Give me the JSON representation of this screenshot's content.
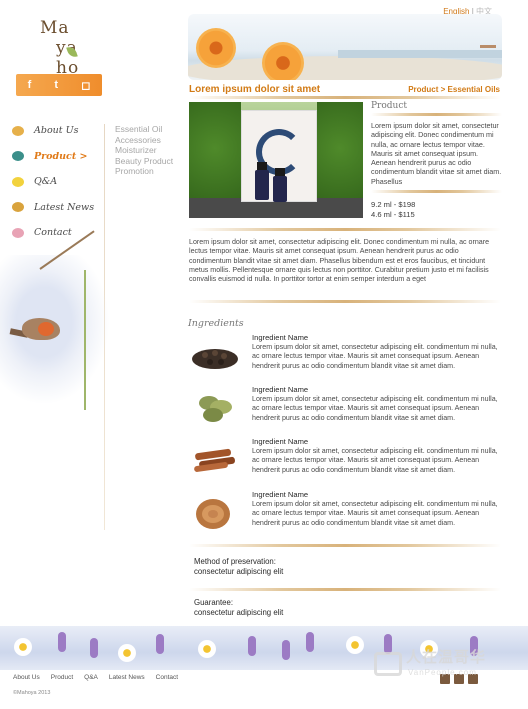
{
  "header": {
    "logo_top": "Ma",
    "logo_bottom": "ya ho",
    "lang_english": "English",
    "lang_sep": "|",
    "lang_chinese": "中文"
  },
  "social": {
    "facebook_icon": "f",
    "twitter_icon": "t",
    "instagram_icon": "◻"
  },
  "nav": {
    "items": [
      {
        "label": "About Us",
        "icon_color": "#e6b04a",
        "active": false
      },
      {
        "label": "Product >",
        "icon_color": "#3b8f8a",
        "active": true
      },
      {
        "label": "Q&A",
        "icon_color": "#f2d23d",
        "active": false
      },
      {
        "label": "Latest News",
        "icon_color": "#d9a33d",
        "active": false
      },
      {
        "label": "Contact",
        "icon_color": "#e8a3b5",
        "active": false
      }
    ]
  },
  "subnav": {
    "items": [
      "Essential Oil",
      "Accessories",
      "Moisturizer",
      "Beauty Product",
      "Promotion"
    ]
  },
  "main": {
    "title": "Lorem ipsum dolor sit amet",
    "breadcrumb": "Product > Essential Oils",
    "product_heading": "Product",
    "product_description": "Lorem ipsum dolor sit amet, consectetur adipiscing elit. Donec condimentum mi nulla, ac ornare lectus tempor vitae. Mauris sit amet consequat ipsum. Aenean hendrerit purus ac odio condimentum blandit vitae sit amet diam. Phasellus",
    "price_1": "9.2 ml - $198",
    "price_2": "4.6 ml - $115",
    "long_paragraph": "Lorem ipsum dolor sit amet, consectetur adipiscing elit. Donec condimentum mi nulla, ac ornare lectus tempor vitae. Mauris sit amet consequat ipsum. Aenean hendrerit purus ac odio condimentum blandit vitae sit amet diam. Phasellus bibendum est et eros faucibus, et tincidunt metus mollis. Pellentesque ornare quis lectus non porttitor. Curabitur pretium justo et mi facilisis convallis euismod id nulla. In porttitor tortor at enim semper interdum a eget",
    "ingredients_heading": "Ingredients",
    "ingredients": [
      {
        "name": "Ingredient Name",
        "desc": "Lorem ipsum dolor sit amet, consectetur adipiscing elit.  condimentum mi nulla, ac ornare lectus tempor vitae. Mauris sit amet consequat ipsum. Aenean hendrerit purus ac odio condimentum blandit vitae sit amet diam."
      },
      {
        "name": "Ingredient Name",
        "desc": "Lorem ipsum dolor sit amet, consectetur adipiscing elit.  condimentum mi nulla, ac ornare lectus tempor vitae. Mauris sit amet consequat ipsum. Aenean hendrerit purus ac odio condimentum blandit vitae sit amet diam."
      },
      {
        "name": "Ingredient Name",
        "desc": "Lorem ipsum dolor sit amet, consectetur adipiscing elit.  condimentum mi nulla, ac ornare lectus tempor vitae. Mauris sit amet consequat ipsum. Aenean hendrerit purus ac odio condimentum blandit vitae sit amet diam."
      },
      {
        "name": "Ingredient Name",
        "desc": "Lorem ipsum dolor sit amet, consectetur adipiscing elit.  condimentum mi nulla, ac ornare lectus tempor vitae. Mauris sit amet consequat ipsum. Aenean hendrerit purus ac odio condimentum blandit vitae sit amet diam."
      }
    ],
    "preservation_label": "Method of preservation:",
    "preservation_value": "consectetur adipiscing elit",
    "guarantee_label": "Guarantee:",
    "guarantee_value": "consectetur adipiscing elit"
  },
  "footer": {
    "nav": [
      "About Us",
      "Product",
      "Q&A",
      "Latest News",
      "Contact"
    ],
    "copyright": "©Mahoya 2013"
  },
  "watermark": {
    "title": "人在温哥华",
    "subtitle": "VanPeople.com"
  },
  "colors": {
    "accent": "#d27b16",
    "text": "#4a4a4a"
  }
}
